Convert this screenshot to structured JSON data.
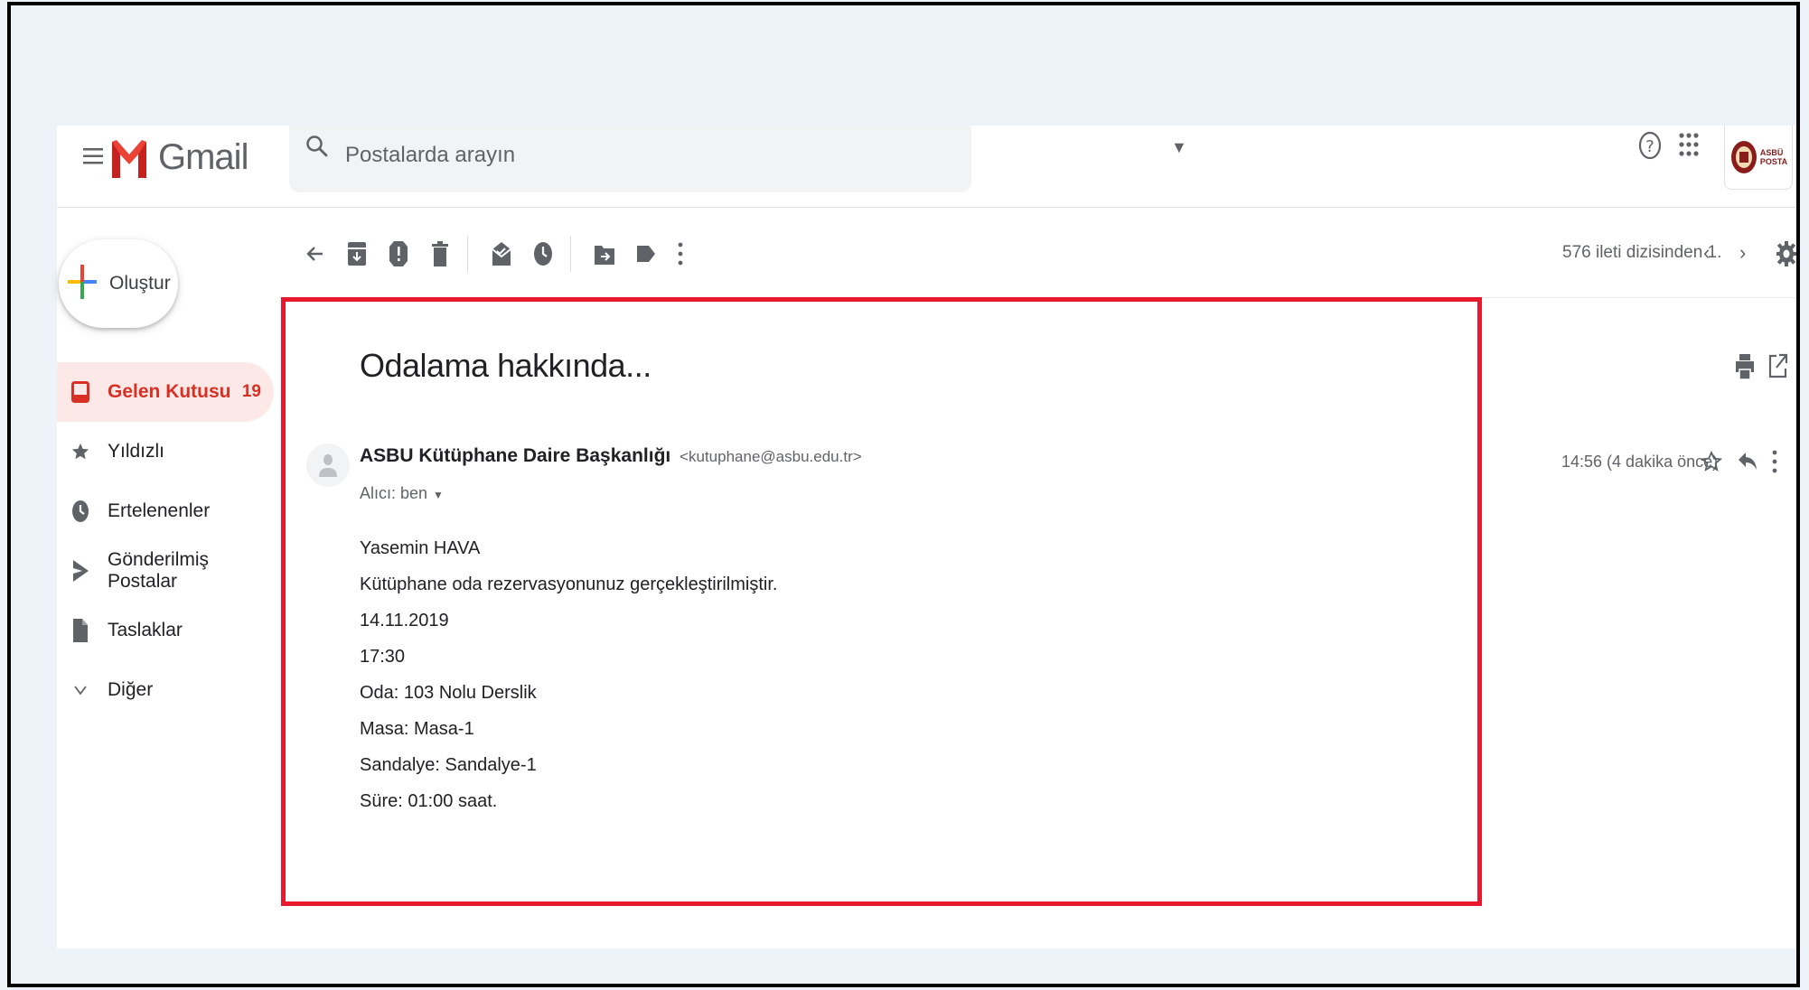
{
  "app": {
    "name": "Gmail"
  },
  "search": {
    "placeholder": "Postalarda arayın"
  },
  "account": {
    "logo_text_line1": "ASBÜ",
    "logo_text_line2": "POSTA"
  },
  "compose": {
    "label": "Oluştur"
  },
  "nav": {
    "items": [
      {
        "label": "Gelen Kutusu",
        "count": "19",
        "icon": "inbox-icon",
        "active": true
      },
      {
        "label": "Yıldızlı",
        "icon": "star-icon"
      },
      {
        "label": "Ertelenenler",
        "icon": "clock-icon"
      },
      {
        "label": "Gönderilmiş Postalar",
        "icon": "send-icon"
      },
      {
        "label": "Taslaklar",
        "icon": "draft-icon"
      },
      {
        "label": "Diğer",
        "icon": "chevron-down-icon"
      }
    ]
  },
  "toolbar": {
    "pagination": "576 ileti dizisinden 1."
  },
  "email": {
    "subject": "Odalama hakkında...",
    "sender_name": "ASBU Kütüphane Daire Başkanlığı",
    "sender_email": "<kutuphane@asbu.edu.tr>",
    "recipient": "Alıcı: ben",
    "time": "14:56 (4 dakika önce)",
    "body": [
      "Yasemin HAVA",
      "Kütüphane oda rezervasyonunuz gerçekleştirilmiştir.",
      "14.11.2019",
      "17:30",
      "Oda: 103 Nolu Derslik",
      "Masa: Masa-1",
      "Sandalye: Sandalye-1",
      "Süre: 01:00 saat."
    ]
  },
  "colors": {
    "highlight": "#e8192c",
    "active_nav_bg": "#fce8e6",
    "active_nav_text": "#d93025"
  }
}
